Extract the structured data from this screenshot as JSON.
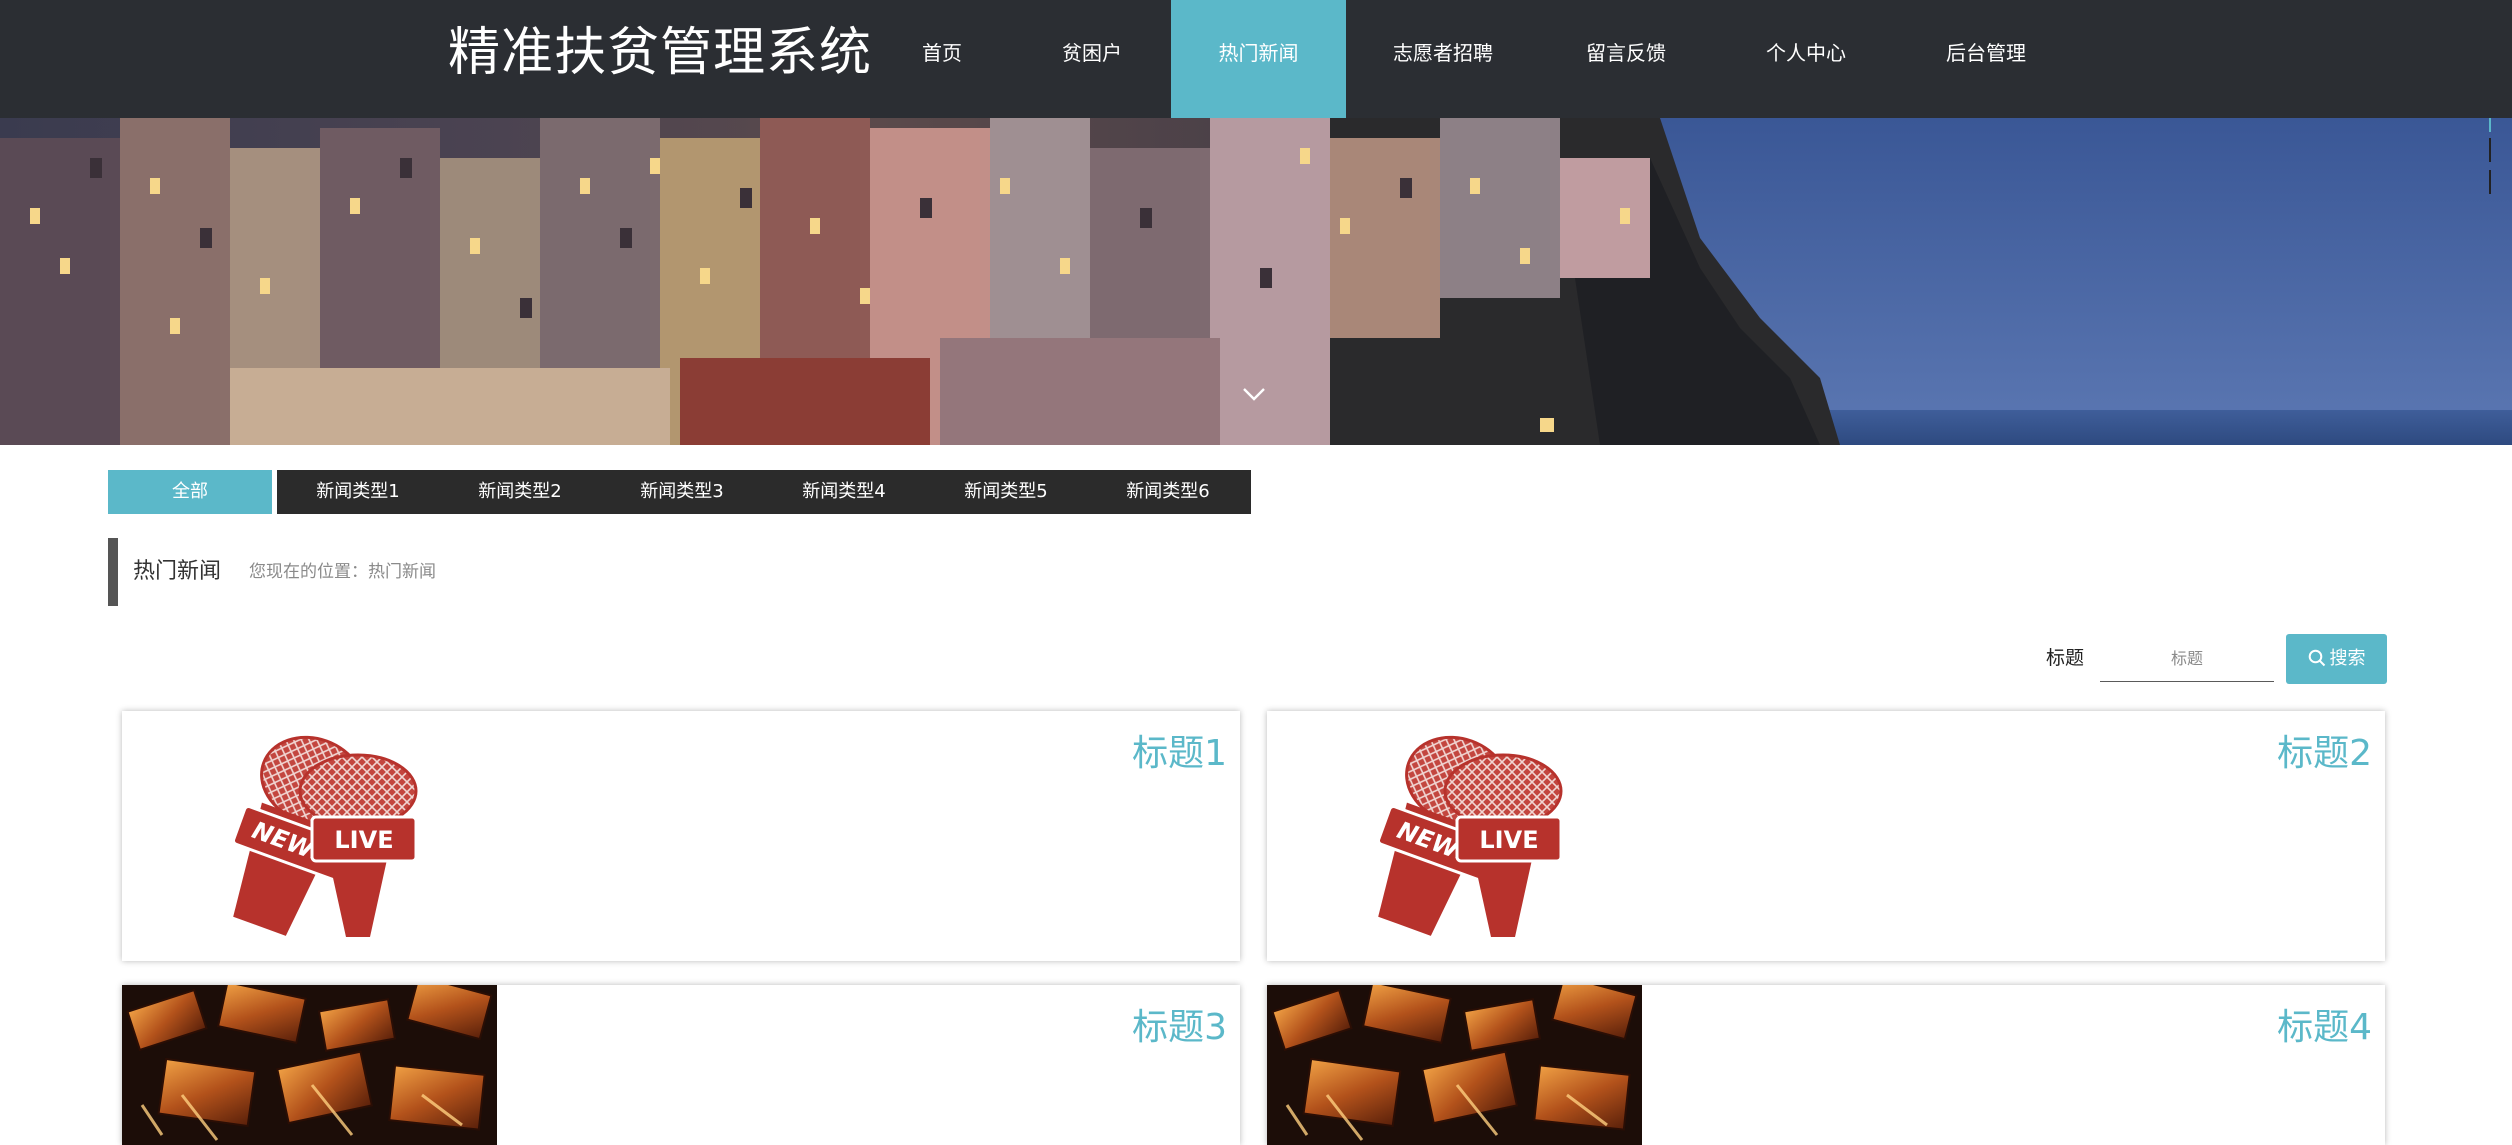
{
  "site": {
    "title": "精准扶贫管理系统"
  },
  "nav": {
    "items": [
      {
        "label": "首页",
        "active": false
      },
      {
        "label": "贫困户",
        "active": false
      },
      {
        "label": "热门新闻",
        "active": true
      },
      {
        "label": "志愿者招聘",
        "active": false
      },
      {
        "label": "留言反馈",
        "active": false
      },
      {
        "label": "个人中心",
        "active": false
      },
      {
        "label": "后台管理",
        "active": false
      }
    ]
  },
  "banner": {
    "icon": "chevron-down-icon"
  },
  "categories": {
    "items": [
      {
        "label": "全部",
        "active": true
      },
      {
        "label": "新闻类型1",
        "active": false
      },
      {
        "label": "新闻类型2",
        "active": false
      },
      {
        "label": "新闻类型3",
        "active": false
      },
      {
        "label": "新闻类型4",
        "active": false
      },
      {
        "label": "新闻类型5",
        "active": false
      },
      {
        "label": "新闻类型6",
        "active": false
      }
    ]
  },
  "breadcrumb": {
    "title": "热门新闻",
    "location": "您现在的位置：热门新闻"
  },
  "search": {
    "label": "标题",
    "placeholder": "标题",
    "button_label": "搜索",
    "icon": "search-icon"
  },
  "news": {
    "items": [
      {
        "title": "标题1",
        "image": "news-live-microphones"
      },
      {
        "title": "标题2",
        "image": "news-live-microphones"
      },
      {
        "title": "标题3",
        "image": "metal-letters-photo"
      },
      {
        "title": "标题4",
        "image": "metal-letters-photo"
      }
    ]
  },
  "mic_image": {
    "news_text": "NEWS",
    "live_text": "LIVE"
  },
  "colors": {
    "accent": "#5bb8c9",
    "topbar": "#2b2e33",
    "category_bar": "#2b2b2b",
    "mic_red": "#b7322c"
  }
}
